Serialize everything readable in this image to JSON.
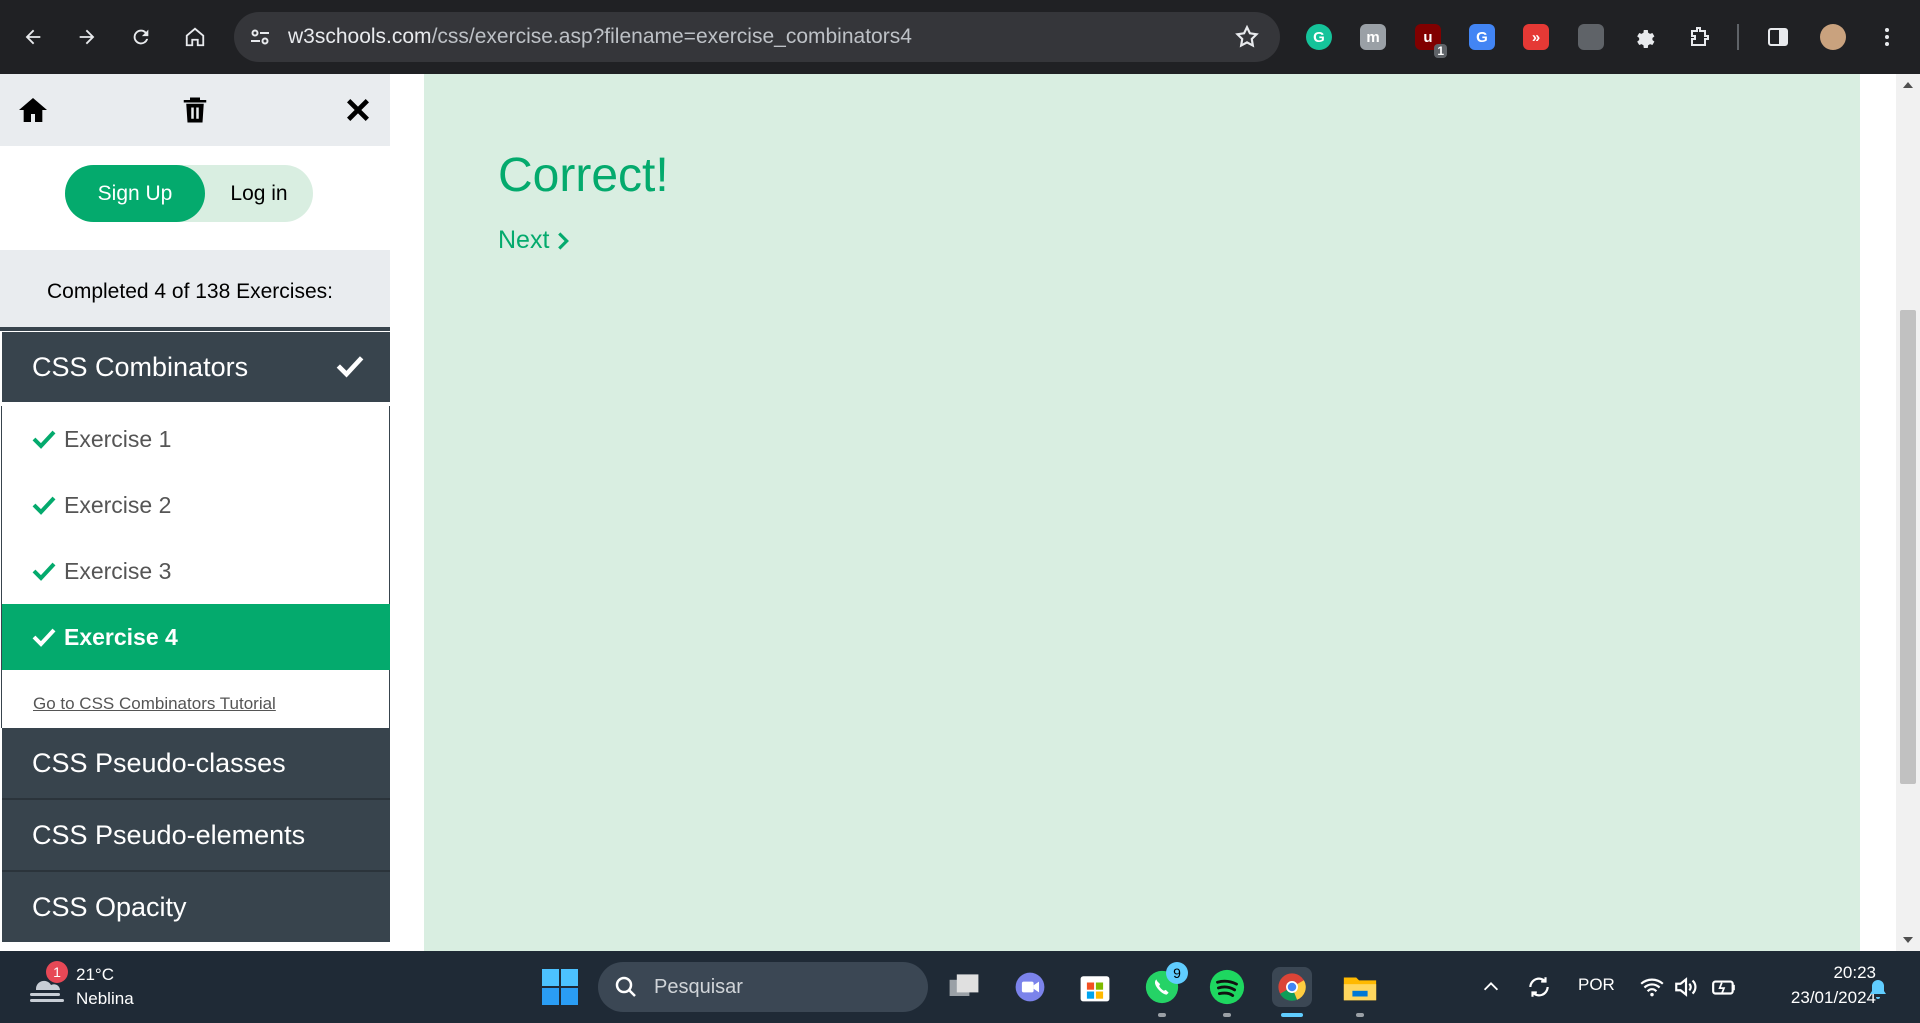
{
  "browser": {
    "url_host": "w3schools.com",
    "url_path": "/css/exercise.asp?filename=exercise_combinators4",
    "extensions": [
      {
        "name": "grammarly-icon",
        "letter": "G",
        "color": "#15c39a"
      },
      {
        "name": "m-extension-icon",
        "letter": "m",
        "color": "#9aa0a6"
      },
      {
        "name": "ublock-icon",
        "letter": "u",
        "color": "#800000",
        "badge": "1"
      },
      {
        "name": "google-translate-icon",
        "letter": "G",
        "color": "#4285f4"
      },
      {
        "name": "red-extension-icon",
        "letter": "»",
        "color": "#e53935"
      },
      {
        "name": "grey-extension-icon",
        "letter": "",
        "color": "#5f6368"
      }
    ]
  },
  "sidebar": {
    "signup_label": "Sign Up",
    "login_label": "Log in",
    "progress_text": "Completed 4 of 138 Exercises:",
    "current_category": "CSS Combinators",
    "exercises": [
      {
        "label": "Exercise 1",
        "done": true
      },
      {
        "label": "Exercise 2",
        "done": true
      },
      {
        "label": "Exercise 3",
        "done": true
      },
      {
        "label": "Exercise 4",
        "done": true,
        "active": true
      }
    ],
    "tutorial_link": "Go to CSS Combinators Tutorial",
    "other_categories": [
      "CSS Pseudo-classes",
      "CSS Pseudo-elements",
      "CSS Opacity"
    ]
  },
  "main": {
    "result_title": "Correct!",
    "next_label": "Next"
  },
  "colors": {
    "accent": "#04aa6d",
    "main_bg": "#d9eee1",
    "sidebar_dark": "#38444d"
  },
  "taskbar": {
    "weather_temp": "21°C",
    "weather_desc": "Neblina",
    "weather_badge": "1",
    "search_placeholder": "Pesquisar",
    "whatsapp_badge": "9",
    "language": "POR",
    "time": "20:23",
    "date": "23/01/2024"
  }
}
